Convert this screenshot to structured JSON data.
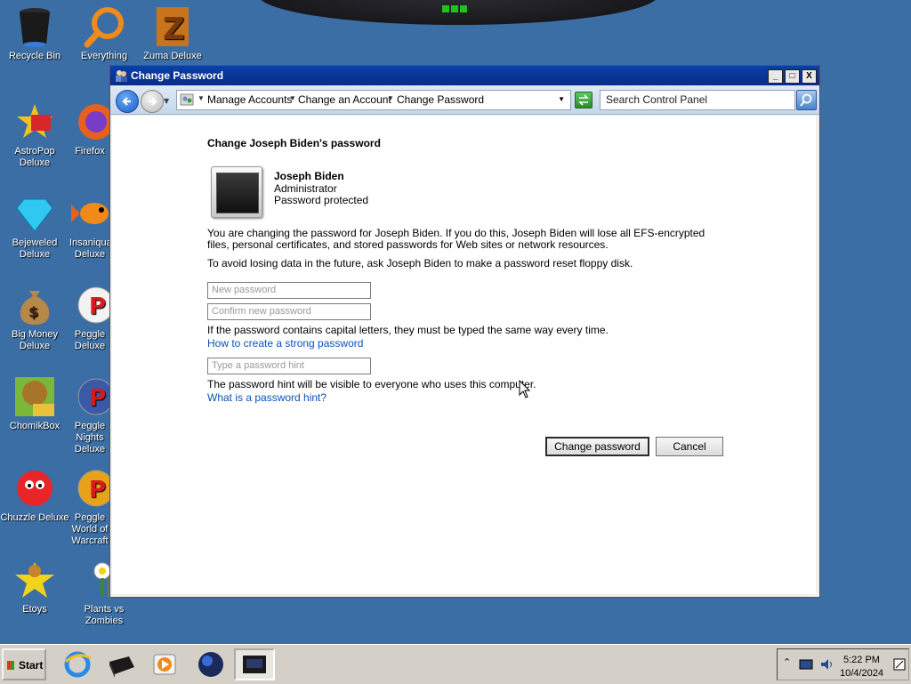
{
  "desktop": {
    "icons": [
      {
        "label": "Recycle Bin"
      },
      {
        "label": "Everything"
      },
      {
        "label": "Zuma Deluxe"
      },
      {
        "label": "AstroPop Deluxe"
      },
      {
        "label": "Firefox"
      },
      {
        "label": "Bejeweled Deluxe"
      },
      {
        "label": "Insaniquarium Deluxe"
      },
      {
        "label": "Big Money Deluxe"
      },
      {
        "label": "Peggle Deluxe"
      },
      {
        "label": "ChomikBox"
      },
      {
        "label": "Peggle Nights Deluxe"
      },
      {
        "label": "Chuzzle Deluxe"
      },
      {
        "label": "Peggle World of Warcraft"
      },
      {
        "label": "Etoys"
      },
      {
        "label": "Plants vs Zombies"
      }
    ]
  },
  "window": {
    "title": "Change Password",
    "buttons": {
      "minimize": "_",
      "maximize": "□",
      "close": "X"
    },
    "breadcrumbs": [
      "Manage Accounts",
      "Change an Account",
      "Change Password"
    ],
    "search_placeholder": "Search Control Panel"
  },
  "page": {
    "heading": "Change Joseph Biden's password",
    "user": {
      "name": "Joseph Biden",
      "role": "Administrator",
      "status": "Password protected"
    },
    "warning": "You are changing the password for Joseph Biden.  If you do this, Joseph Biden will lose all EFS-encrypted files, personal certificates, and stored passwords for Web sites or network resources.",
    "advice": "To avoid losing data in the future, ask Joseph Biden to make a password reset floppy disk.",
    "new_password_placeholder": "New password",
    "confirm_password_placeholder": "Confirm new password",
    "caps_note": "If the password contains capital letters, they must be typed the same way every time.",
    "strong_password_link": "How to create a strong password",
    "hint_placeholder": "Type a password hint",
    "hint_note": "The password hint will be visible to everyone who uses this computer.",
    "hint_link": "What is a password hint?",
    "change_button": "Change password",
    "cancel_button": "Cancel"
  },
  "taskbar": {
    "start_label": "Start",
    "time": "5:22 PM",
    "date": "10/4/2024"
  },
  "colors": {
    "desktop": "#3a6ea5",
    "titlebar": "#0b3fa8",
    "link": "#0b54b5"
  }
}
